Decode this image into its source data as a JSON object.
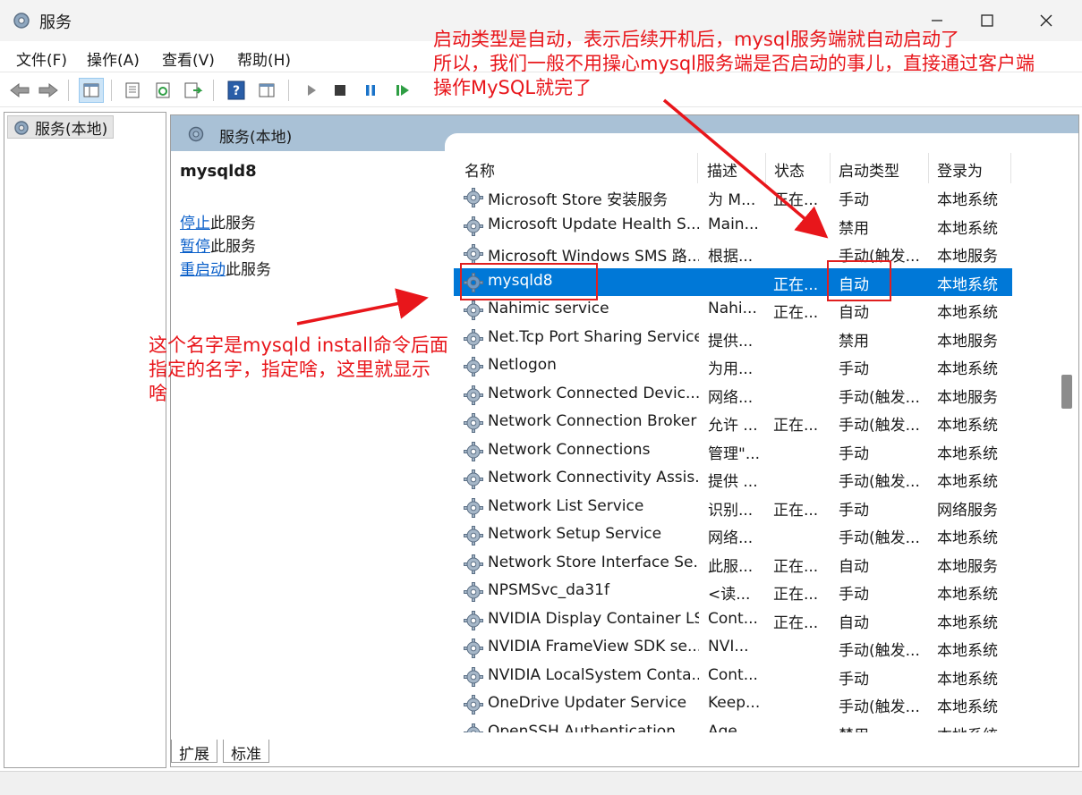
{
  "window": {
    "title": "服务"
  },
  "menu": [
    "文件(F)",
    "操作(A)",
    "查看(V)",
    "帮助(H)"
  ],
  "tree": {
    "root_label": "服务(本地)"
  },
  "panel": {
    "header": "服务(本地)",
    "selected_service": "mysqld8",
    "actions": [
      {
        "link": "停止",
        "suffix": "此服务"
      },
      {
        "link": "暂停",
        "suffix": "此服务"
      },
      {
        "link": "重启动",
        "suffix": "此服务"
      }
    ]
  },
  "list": {
    "columns": [
      "名称",
      "描述",
      "状态",
      "启动类型",
      "登录为"
    ],
    "rows": [
      {
        "name": "Microsoft Store 安装服务",
        "desc": "为 M...",
        "status": "正在...",
        "startup": "手动",
        "logon": "本地系统"
      },
      {
        "name": "Microsoft Update Health S...",
        "desc": "Main...",
        "status": "",
        "startup": "禁用",
        "logon": "本地系统"
      },
      {
        "name": "Microsoft Windows SMS 路...",
        "desc": "根据...",
        "status": "",
        "startup": "手动(触发...",
        "logon": "本地服务"
      },
      {
        "name": "mysqld8",
        "desc": "",
        "status": "正在...",
        "startup": "自动",
        "logon": "本地系统",
        "selected": true
      },
      {
        "name": "Nahimic service",
        "desc": "Nahi...",
        "status": "正在...",
        "startup": "自动",
        "logon": "本地系统"
      },
      {
        "name": "Net.Tcp Port Sharing Service",
        "desc": "提供...",
        "status": "",
        "startup": "禁用",
        "logon": "本地服务"
      },
      {
        "name": "Netlogon",
        "desc": "为用...",
        "status": "",
        "startup": "手动",
        "logon": "本地系统"
      },
      {
        "name": "Network Connected Devic...",
        "desc": "网络...",
        "status": "",
        "startup": "手动(触发...",
        "logon": "本地服务"
      },
      {
        "name": "Network Connection Broker",
        "desc": "允许 ...",
        "status": "正在...",
        "startup": "手动(触发...",
        "logon": "本地系统"
      },
      {
        "name": "Network Connections",
        "desc": "管理\"...",
        "status": "",
        "startup": "手动",
        "logon": "本地系统"
      },
      {
        "name": "Network Connectivity Assis...",
        "desc": "提供 ...",
        "status": "",
        "startup": "手动(触发...",
        "logon": "本地系统"
      },
      {
        "name": "Network List Service",
        "desc": "识别...",
        "status": "正在...",
        "startup": "手动",
        "logon": "网络服务"
      },
      {
        "name": "Network Setup Service",
        "desc": "网络...",
        "status": "",
        "startup": "手动(触发...",
        "logon": "本地系统"
      },
      {
        "name": "Network Store Interface Se...",
        "desc": "此服...",
        "status": "正在...",
        "startup": "自动",
        "logon": "本地服务"
      },
      {
        "name": "NPSMSvc_da31f",
        "desc": "<读...",
        "status": "正在...",
        "startup": "手动",
        "logon": "本地系统"
      },
      {
        "name": "NVIDIA Display Container LS",
        "desc": "Cont...",
        "status": "正在...",
        "startup": "自动",
        "logon": "本地系统"
      },
      {
        "name": "NVIDIA FrameView SDK se...",
        "desc": "NVI...",
        "status": "",
        "startup": "手动(触发...",
        "logon": "本地系统"
      },
      {
        "name": "NVIDIA LocalSystem Conta...",
        "desc": "Cont...",
        "status": "",
        "startup": "手动",
        "logon": "本地系统"
      },
      {
        "name": "OneDrive Updater Service",
        "desc": "Keep...",
        "status": "",
        "startup": "手动(触发...",
        "logon": "本地系统"
      },
      {
        "name": "OpenSSH Authentication ...",
        "desc": "Age...",
        "status": "",
        "startup": "禁用",
        "logon": "本地系统"
      }
    ]
  },
  "tabs": [
    "扩展",
    "标准"
  ],
  "annotations": {
    "top_note": [
      "启动类型是自动，表示后续开机后，mysql服务端就自动启动了",
      "所以，我们一般不用操心mysql服务端是否启动的事儿，直接通过客户端",
      "操作MySQL就完了"
    ],
    "left_note": [
      "这个名字是mysqld install命令后面",
      "指定的名字，指定啥，这里就显示",
      "啥"
    ],
    "color": "#e8161b"
  },
  "colors": {
    "selection": "#0078d7",
    "panel_header": "#a9c1d6",
    "link": "#0a5fc9"
  }
}
